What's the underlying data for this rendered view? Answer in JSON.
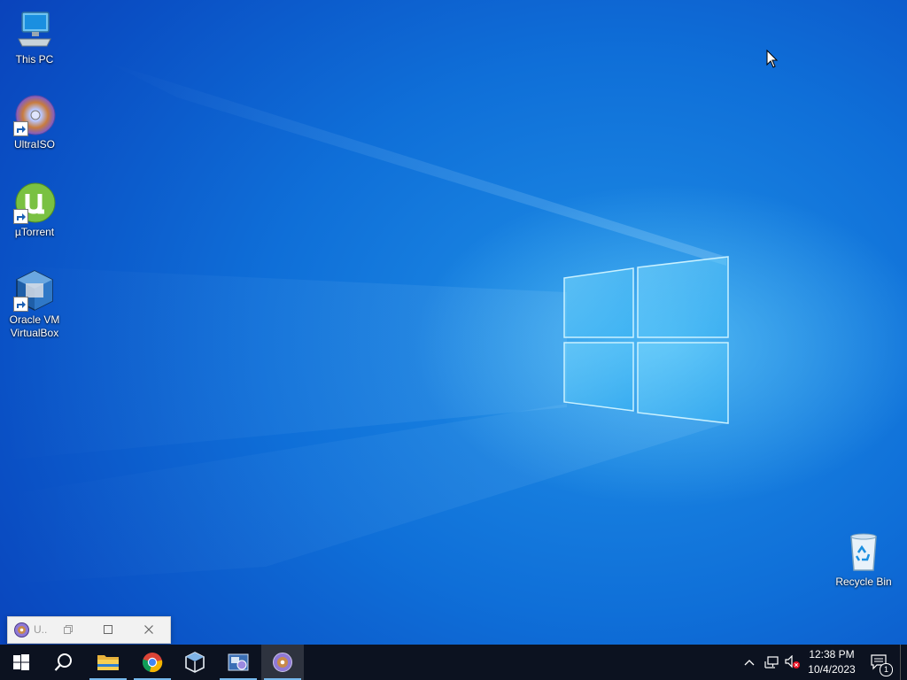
{
  "desktop": {
    "icons": [
      {
        "label": "This PC",
        "icon": "this-pc-icon"
      },
      {
        "label": "UltraISO",
        "icon": "ultraiso-icon"
      },
      {
        "label": "µTorrent",
        "icon": "utorrent-icon"
      },
      {
        "label": "Oracle VM VirtualBox",
        "label_line1": "Oracle VM",
        "label_line2": "VirtualBox",
        "icon": "virtualbox-icon"
      },
      {
        "label": "Recycle Bin",
        "icon": "recycle-bin-icon"
      }
    ],
    "wallpaper": "windows-10-hero"
  },
  "taskbar_preview": {
    "title": "U..",
    "icon": "ultraiso-icon"
  },
  "taskbar": {
    "buttons": [
      {
        "name": "start",
        "icon": "windows-logo-icon"
      },
      {
        "name": "search",
        "icon": "search-icon"
      },
      {
        "name": "file-explorer",
        "icon": "folder-icon"
      },
      {
        "name": "chrome",
        "icon": "chrome-icon"
      },
      {
        "name": "virtualbox",
        "icon": "virtualbox-icon"
      },
      {
        "name": "ultraiso-app",
        "icon": "ultraiso-taskbar-icon"
      },
      {
        "name": "ultraiso-running",
        "icon": "ultraiso-icon"
      }
    ],
    "tray": {
      "time": "12:38 PM",
      "date": "10/4/2023",
      "notification_count": "1"
    }
  },
  "colors": {
    "taskbar_bg": "#0c1220",
    "accent_underline": "#76b9ed",
    "desktop_blue": "#0f6fd8"
  }
}
